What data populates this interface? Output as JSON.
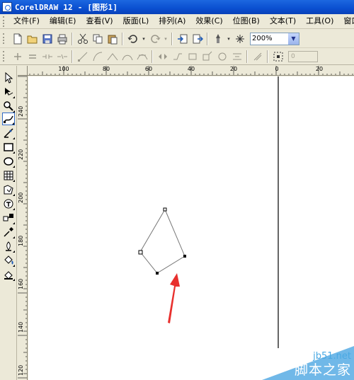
{
  "window": {
    "title": "CorelDRAW 12 - [图形1]"
  },
  "menubar": {
    "items": [
      "文件(F)",
      "编辑(E)",
      "查看(V)",
      "版面(L)",
      "排列(A)",
      "效果(C)",
      "位图(B)",
      "文本(T)",
      "工具(O)",
      "窗口"
    ]
  },
  "toolbar": {
    "zoom_value": "200%",
    "icons": [
      "new-icon",
      "open-icon",
      "save-icon",
      "print-icon",
      "cut-icon",
      "copy-icon",
      "paste-icon",
      "undo-icon",
      "redo-icon",
      "import-icon",
      "export-icon",
      "launcher-icon",
      "zoom-icon"
    ]
  },
  "property_bar": {
    "nudge_value": "0"
  },
  "toolbox": {
    "tools": [
      "pick-tool-icon",
      "shape-tool-icon",
      "zoom-tool-icon",
      "freehand-tool-icon",
      "smart-fill-tool-icon",
      "rectangle-tool-icon",
      "ellipse-tool-icon",
      "polygon-tool-icon",
      "basic-shapes-tool-icon",
      "text-tool-icon",
      "interactive-blend-tool-icon",
      "eyedropper-tool-icon",
      "outline-tool-icon",
      "fill-tool-icon",
      "interactive-fill-tool-icon"
    ],
    "active_index": 3
  },
  "rulers": {
    "horizontal_labels": [
      "100",
      "80",
      "60",
      "40",
      "20",
      "0",
      "20"
    ],
    "vertical_labels": [
      "240",
      "220",
      "200",
      "180",
      "160",
      "140",
      "120"
    ]
  },
  "colors": {
    "arrow": "#e8302e",
    "accent": "#316ac5",
    "titlebar": "#0a4fd0"
  },
  "watermark": {
    "url": "jb51.net",
    "name": "脚本之家"
  }
}
